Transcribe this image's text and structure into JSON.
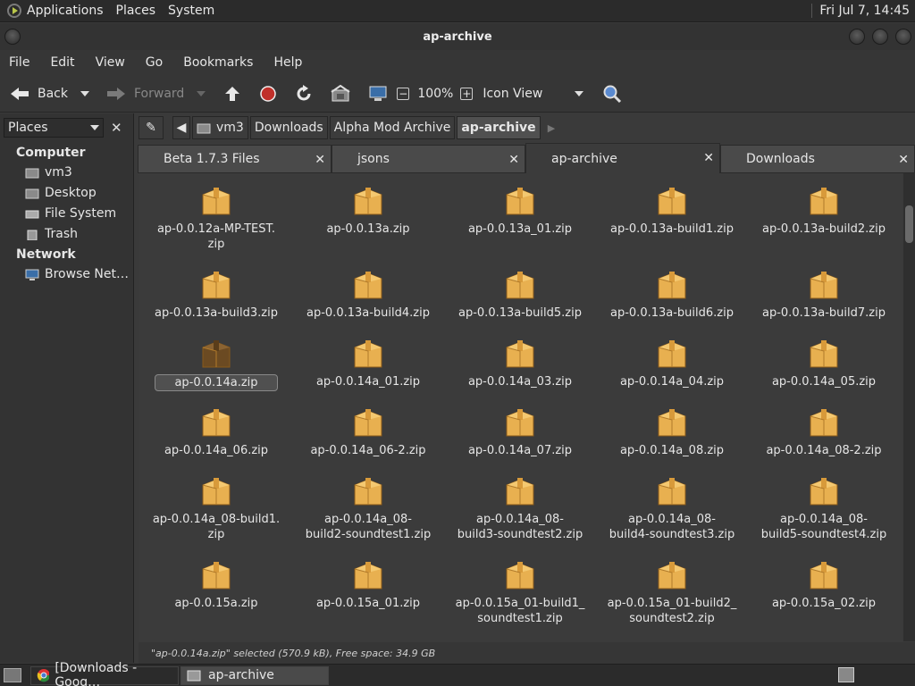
{
  "top_panel": {
    "menus": [
      "Applications",
      "Places",
      "System"
    ],
    "clock": "Fri Jul 7, 14:45"
  },
  "window": {
    "title": "ap-archive"
  },
  "menubar": [
    "File",
    "Edit",
    "View",
    "Go",
    "Bookmarks",
    "Help"
  ],
  "toolbar": {
    "back": "Back",
    "forward": "Forward",
    "zoom": "100%",
    "view_mode": "Icon View"
  },
  "sidepane": {
    "selector": "Places",
    "groups": [
      {
        "label": "Computer",
        "items": [
          "vm3",
          "Desktop",
          "File System",
          "Trash"
        ]
      },
      {
        "label": "Network",
        "items": [
          "Browse Net…"
        ]
      }
    ]
  },
  "pathbar": {
    "crumbs": [
      "vm3",
      "Downloads",
      "Alpha Mod Archive",
      "ap-archive"
    ]
  },
  "tabs": [
    "Beta 1.7.3 Files",
    "jsons",
    "ap-archive",
    "Downloads"
  ],
  "files": [
    "ap-0.0.12a-MP-TEST.\nzip",
    "ap-0.0.13a.zip",
    "ap-0.0.13a_01.zip",
    "ap-0.0.13a-build1.zip",
    "ap-0.0.13a-build2.zip",
    "ap-0.0.13a-build3.zip",
    "ap-0.0.13a-build4.zip",
    "ap-0.0.13a-build5.zip",
    "ap-0.0.13a-build6.zip",
    "ap-0.0.13a-build7.zip",
    "ap-0.0.14a.zip",
    "ap-0.0.14a_01.zip",
    "ap-0.0.14a_03.zip",
    "ap-0.0.14a_04.zip",
    "ap-0.0.14a_05.zip",
    "ap-0.0.14a_06.zip",
    "ap-0.0.14a_06-2.zip",
    "ap-0.0.14a_07.zip",
    "ap-0.0.14a_08.zip",
    "ap-0.0.14a_08-2.zip",
    "ap-0.0.14a_08-build1.\nzip",
    "ap-0.0.14a_08-\nbuild2-soundtest1.zip",
    "ap-0.0.14a_08-\nbuild3-soundtest2.zip",
    "ap-0.0.14a_08-\nbuild4-soundtest3.zip",
    "ap-0.0.14a_08-\nbuild5-soundtest4.zip",
    "ap-0.0.15a.zip",
    "ap-0.0.15a_01.zip",
    "ap-0.0.15a_01-build1_\nsoundtest1.zip",
    "ap-0.0.15a_01-build2_\nsoundtest2.zip",
    "ap-0.0.15a_02.zip"
  ],
  "status": "\"ap-0.0.14a.zip\" selected (570.9 kB), Free space: 34.9 GB",
  "taskbar": [
    "[Downloads - Goog…",
    "ap-archive"
  ]
}
